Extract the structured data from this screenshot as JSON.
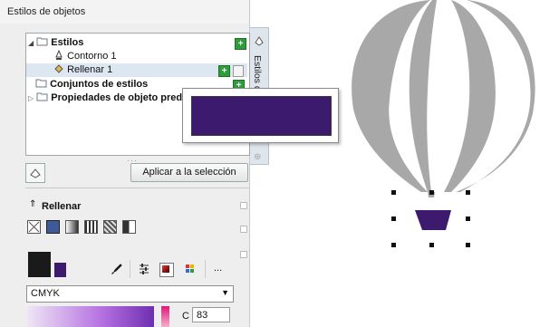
{
  "panel": {
    "title": "Estilos de objetos",
    "close": "×",
    "side_tab": "Estilos de",
    "tree": {
      "styles_group": "Estilos",
      "outline_item": "Contorno 1",
      "fill_item": "Rellenar 1",
      "style_sets": "Conjuntos de estilos",
      "default_props": "Propiedades de objeto prede"
    },
    "apply_button": "Aplicar a la selección",
    "separator": "···"
  },
  "fill_section": {
    "title": "Rellenar",
    "color_model": "CMYK",
    "c_label": "C",
    "c_value": "83",
    "more": "..."
  },
  "colors": {
    "fill": "#3c1a6d",
    "outline": "#1a1a1a",
    "balloon_gray": "#a8a8a8",
    "add_green": "#2e9e3a"
  },
  "icons": [
    "folder-icon",
    "pen-icon",
    "fill-bucket-icon",
    "plus-icon",
    "trash-icon",
    "eyedropper-icon",
    "palette-icon",
    "color-swatch-icon"
  ]
}
